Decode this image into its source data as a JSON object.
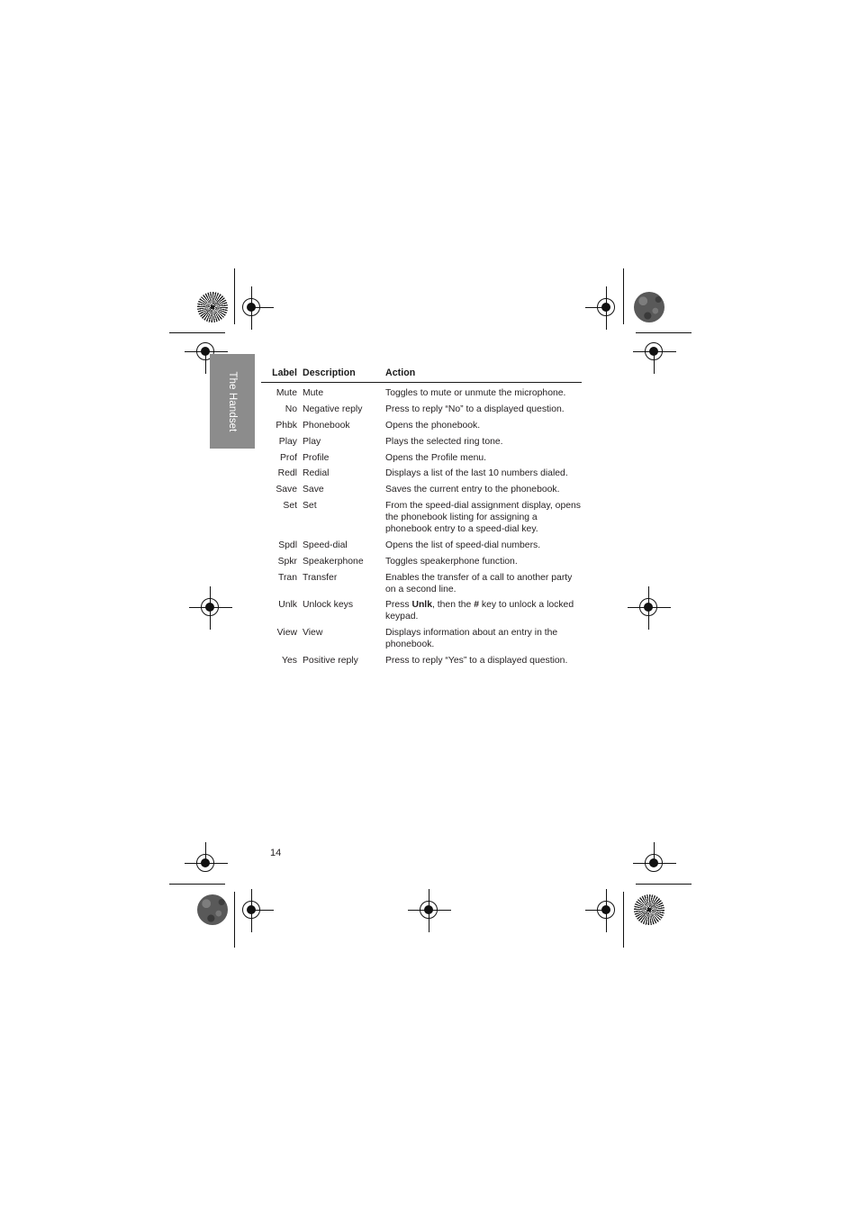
{
  "page": {
    "folio": "14",
    "side_tab_label": "The Handset",
    "tab_color": "#8c8c8c",
    "text_color": "#231f20"
  },
  "table": {
    "headers": {
      "label": "Label",
      "description": "Description",
      "action": "Action"
    },
    "rows": [
      {
        "label": "Mute",
        "description": "Mute",
        "action": "Toggles to mute or unmute the microphone."
      },
      {
        "label": "No",
        "description": "Negative reply",
        "action": "Press to reply “No” to a displayed question."
      },
      {
        "label": "Phbk",
        "description": "Phonebook",
        "action": "Opens the phonebook."
      },
      {
        "label": "Play",
        "description": "Play",
        "action": "Plays the selected ring tone."
      },
      {
        "label": "Prof",
        "description": "Profile",
        "action": "Opens the Profile menu."
      },
      {
        "label": "Redl",
        "description": "Redial",
        "action": "Displays a list of the last 10 numbers dialed."
      },
      {
        "label": "Save",
        "description": "Save",
        "action": "Saves the current entry to the phonebook."
      },
      {
        "label": "Set",
        "description": "Set",
        "action": "From the speed-dial assignment display, opens the phonebook listing for assigning a phonebook entry to a speed-dial key."
      },
      {
        "label": "Spdl",
        "description": "Speed-dial",
        "action": "Opens the list of speed-dial numbers."
      },
      {
        "label": "Spkr",
        "description": "Speakerphone",
        "action": "Toggles speakerphone function."
      },
      {
        "label": "Tran",
        "description": "Transfer",
        "action": "Enables the transfer of a call to another party on a second line."
      },
      {
        "label": "Unlk",
        "description": "Unlock keys",
        "action_html": "Press <b>Unlk</b>, then the <b>#</b> key to unlock a locked keypad.",
        "action": "Press Unlk, then the # key to unlock a locked keypad."
      },
      {
        "label": "View",
        "description": "View",
        "action": "Displays information about an entry in the phonebook."
      },
      {
        "label": "Yes",
        "description": "Positive reply",
        "action": "Press to reply “Yes” to a displayed question."
      }
    ]
  }
}
